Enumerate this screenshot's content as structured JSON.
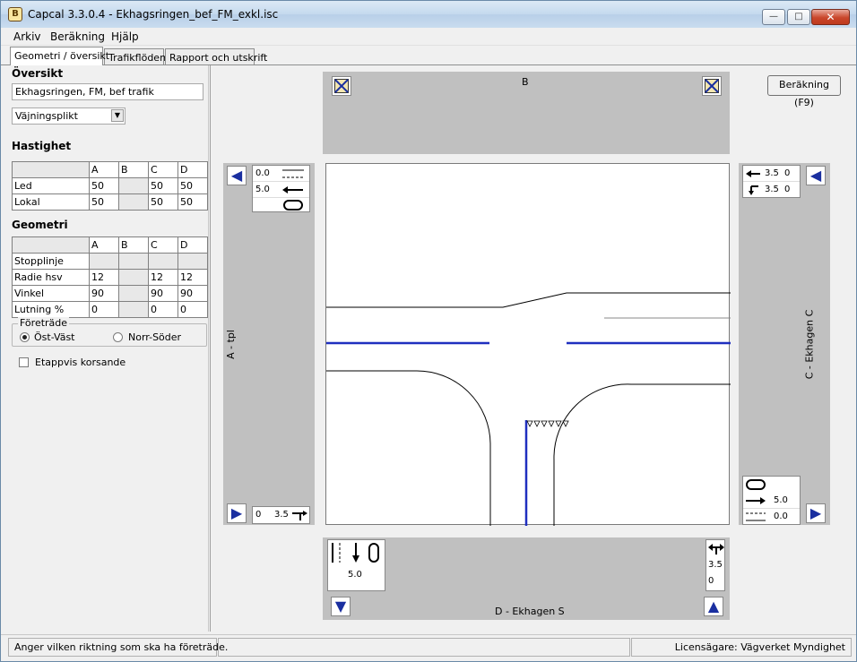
{
  "window": {
    "title": "Capcal 3.3.0.4 - Ekhagsringen_bef_FM_exkl.isc",
    "icon_letter": "B",
    "minimize": "—",
    "maximize": "□",
    "close": "✕"
  },
  "menu": [
    "Arkiv",
    "Beräkning",
    "Hjälp"
  ],
  "tabs": [
    "Geometri / översikt",
    "Trafikflöden",
    "Rapport och utskrift"
  ],
  "left": {
    "overview_title": "Översikt",
    "overview_value": "Ekhagsringen, FM, bef trafik",
    "control_type": "Väjningsplikt",
    "speed_title": "Hastighet",
    "speed_table": {
      "headers": [
        "",
        "A",
        "B",
        "C",
        "D"
      ],
      "rows": [
        [
          "Led",
          "50",
          "",
          "50",
          "50"
        ],
        [
          "Lokal",
          "50",
          "",
          "50",
          "50"
        ]
      ]
    },
    "geometry_title": "Geometri",
    "geometry_table": {
      "headers": [
        "",
        "A",
        "B",
        "C",
        "D"
      ],
      "rows": [
        [
          "Stopplinje",
          "",
          "",
          "",
          ""
        ],
        [
          "Radie hsv",
          "12",
          "",
          "12",
          "12"
        ],
        [
          "Vinkel",
          "90",
          "",
          "90",
          "90"
        ],
        [
          "Lutning %",
          "0",
          "",
          "0",
          "0"
        ]
      ]
    },
    "priority_title": "Företräde",
    "priority_options": [
      "Öst-Väst",
      "Norr-Söder"
    ],
    "stepwise_label": "Etappvis korsande"
  },
  "canvas": {
    "calc_button": "Beräkning (F9)",
    "approach_b_label": "B",
    "approach_a_label": "A - tpl",
    "approach_c_label": "C - Ekhagen C",
    "approach_d_label": "D - Ekhagen S",
    "a_lanes": {
      "row1": "0.0",
      "row2": "5.0",
      "bottom_left": "0",
      "bottom_right": "3.5"
    },
    "c_lanes": {
      "r1a": "3.5",
      "r1b": "0",
      "r2a": "3.5",
      "r2b": "0",
      "b1": "5.0",
      "b2": "0.0"
    },
    "d_lanes": {
      "lane_val": "5.0",
      "right1": "3.5",
      "right2": "0"
    },
    "colors": {
      "lane_blue": "#1f2fbf",
      "approach_gray": "#c0c0c0"
    }
  },
  "status": {
    "hint": "Anger vilken riktning som ska ha företräde.",
    "middle": "",
    "licensee": "Licensägare: Vägverket Myndighet"
  }
}
